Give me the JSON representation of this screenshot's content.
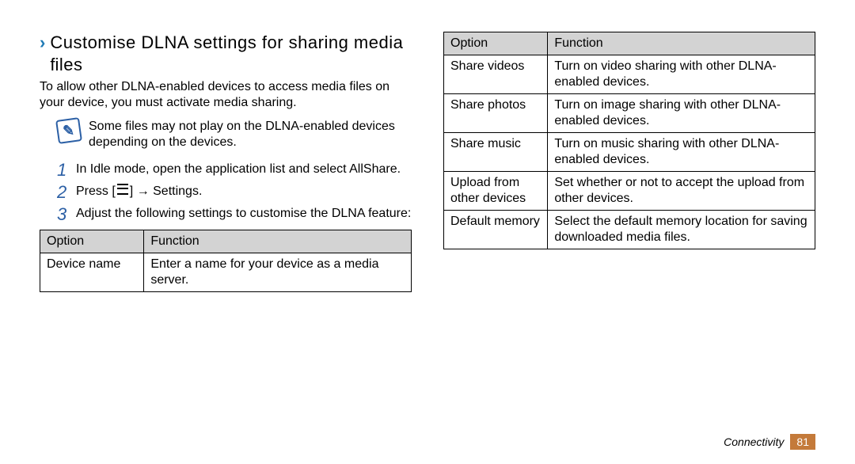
{
  "heading": "Customise DLNA settings for sharing media ﬁles",
  "intro": "To allow other DLNA-enabled devices to access media ﬁles on your device, you must activate media sharing.",
  "note": "Some ﬁles may not play on the DLNA-enabled devices depending on the devices.",
  "steps": {
    "s1": "In Idle mode, open the application list and select AllShare.",
    "s2_pre": "Press [",
    "s2_post": "] → Settings.",
    "s3": "Adjust the following settings to customise the DLNA feature:"
  },
  "table_headers": {
    "opt": "Option",
    "func": "Function"
  },
  "left_table": [
    {
      "opt": "Device name",
      "func": "Enter a name for your device as a media server."
    }
  ],
  "right_table": [
    {
      "opt": "Share videos",
      "func": "Turn on video sharing with other DLNA-enabled devices."
    },
    {
      "opt": "Share photos",
      "func": "Turn on image sharing with other DLNA-enabled devices."
    },
    {
      "opt": "Share music",
      "func": "Turn on music sharing with other DLNA-enabled devices."
    },
    {
      "opt": "Upload from other devices",
      "func": "Set whether or not to accept the upload from other devices."
    },
    {
      "opt": "Default memory",
      "func": "Select the default memory location for saving downloaded media ﬁles."
    }
  ],
  "footer": {
    "section": "Connectivity",
    "page": "81"
  }
}
